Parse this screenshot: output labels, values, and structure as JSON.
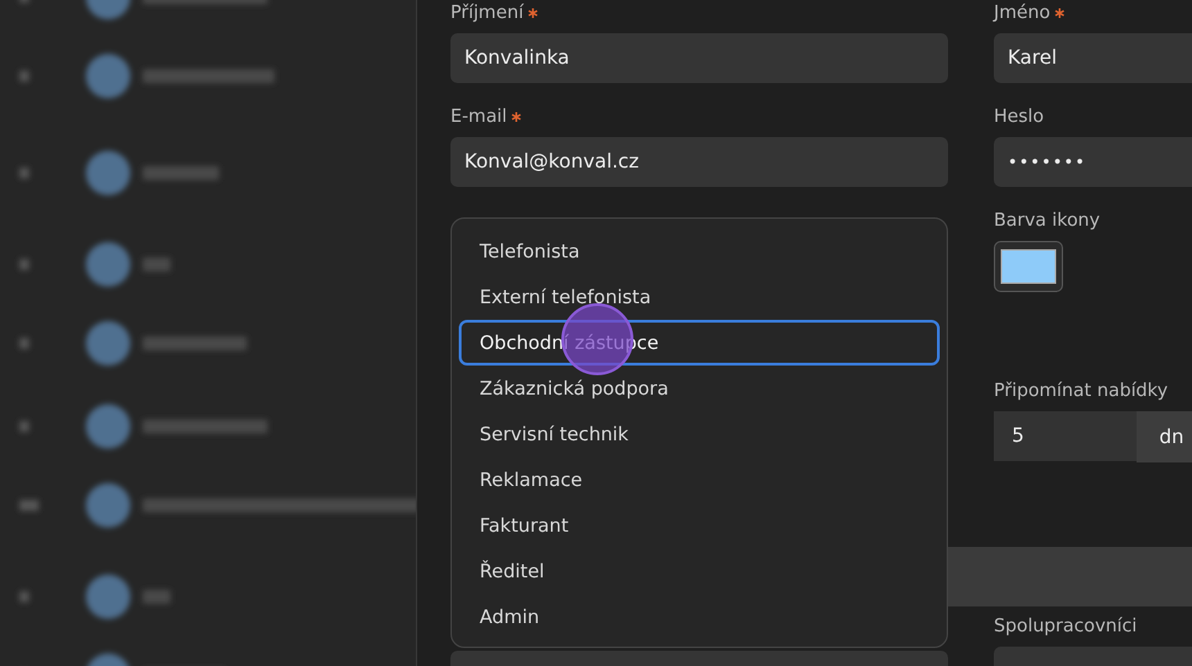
{
  "left_fields": [
    {
      "label": "Příjmení",
      "required": true,
      "kind": "text",
      "value": "Konvalinka"
    },
    {
      "label": "E-mail",
      "required": true,
      "kind": "text",
      "value": "Konval@konval.cz"
    }
  ],
  "right_fields": [
    {
      "label": "Jméno",
      "required": true,
      "kind": "text",
      "value": "Karel"
    },
    {
      "label": "Heslo",
      "required": false,
      "kind": "password",
      "value": "•••••••"
    },
    {
      "label": "Barva ikony",
      "required": false,
      "kind": "color",
      "color": "#8ecbf9"
    },
    {
      "label": "Připomínat nabídky",
      "required": false,
      "kind": "number_unit",
      "value": "5",
      "unit": "dn"
    }
  ],
  "lower_fields": [
    {
      "label": "Spolupracovníci",
      "required": false
    }
  ],
  "dropdown": {
    "options": [
      {
        "label": "Telefonista",
        "selected": false
      },
      {
        "label": "Externí telefonista",
        "selected": false
      },
      {
        "label": "Obchodní zástupce",
        "selected": true
      },
      {
        "label": "Zákaznická podpora",
        "selected": false
      },
      {
        "label": "Servisní technik",
        "selected": false
      },
      {
        "label": "Reklamace",
        "selected": false
      },
      {
        "label": "Fakturant",
        "selected": false
      },
      {
        "label": "Ředitel",
        "selected": false
      },
      {
        "label": "Admin",
        "selected": false
      }
    ]
  }
}
